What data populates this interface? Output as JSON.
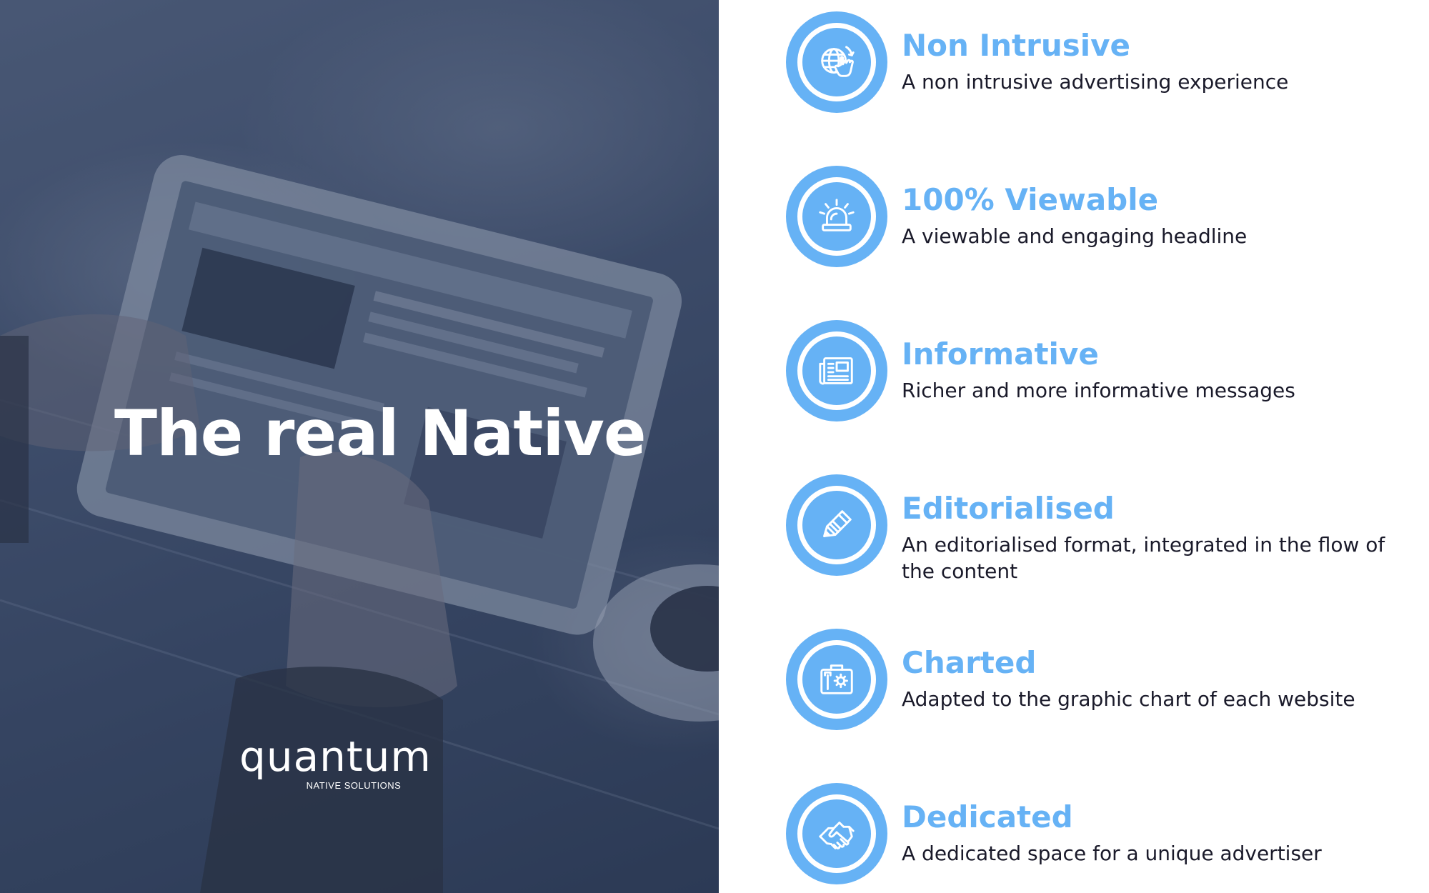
{
  "hero": {
    "title": "The real Native",
    "logo": {
      "word": "quantum",
      "tagline": "NATIVE SOLUTIONS"
    }
  },
  "colors": {
    "accent": "#66b2f5",
    "text_dark": "#1a1a2a",
    "hero_overlay": "#2f3b52"
  },
  "features": [
    {
      "icon": "globe-touch-icon",
      "title": "Non Intrusive",
      "description": "A non intrusive advertising experience"
    },
    {
      "icon": "alarm-light-icon",
      "title": "100% Viewable",
      "description": "A viewable and engaging headline"
    },
    {
      "icon": "newspaper-icon",
      "title": "Informative",
      "description": "Richer and more informative messages"
    },
    {
      "icon": "pencil-icon",
      "title": "Editorialised",
      "description": "An editorialised format, integrated in the flow of the content"
    },
    {
      "icon": "toolbox-icon",
      "title": "Charted",
      "description": "Adapted to the graphic chart of each website"
    },
    {
      "icon": "handshake-icon",
      "title": "Dedicated",
      "description": "A dedicated space for a unique advertiser"
    }
  ]
}
